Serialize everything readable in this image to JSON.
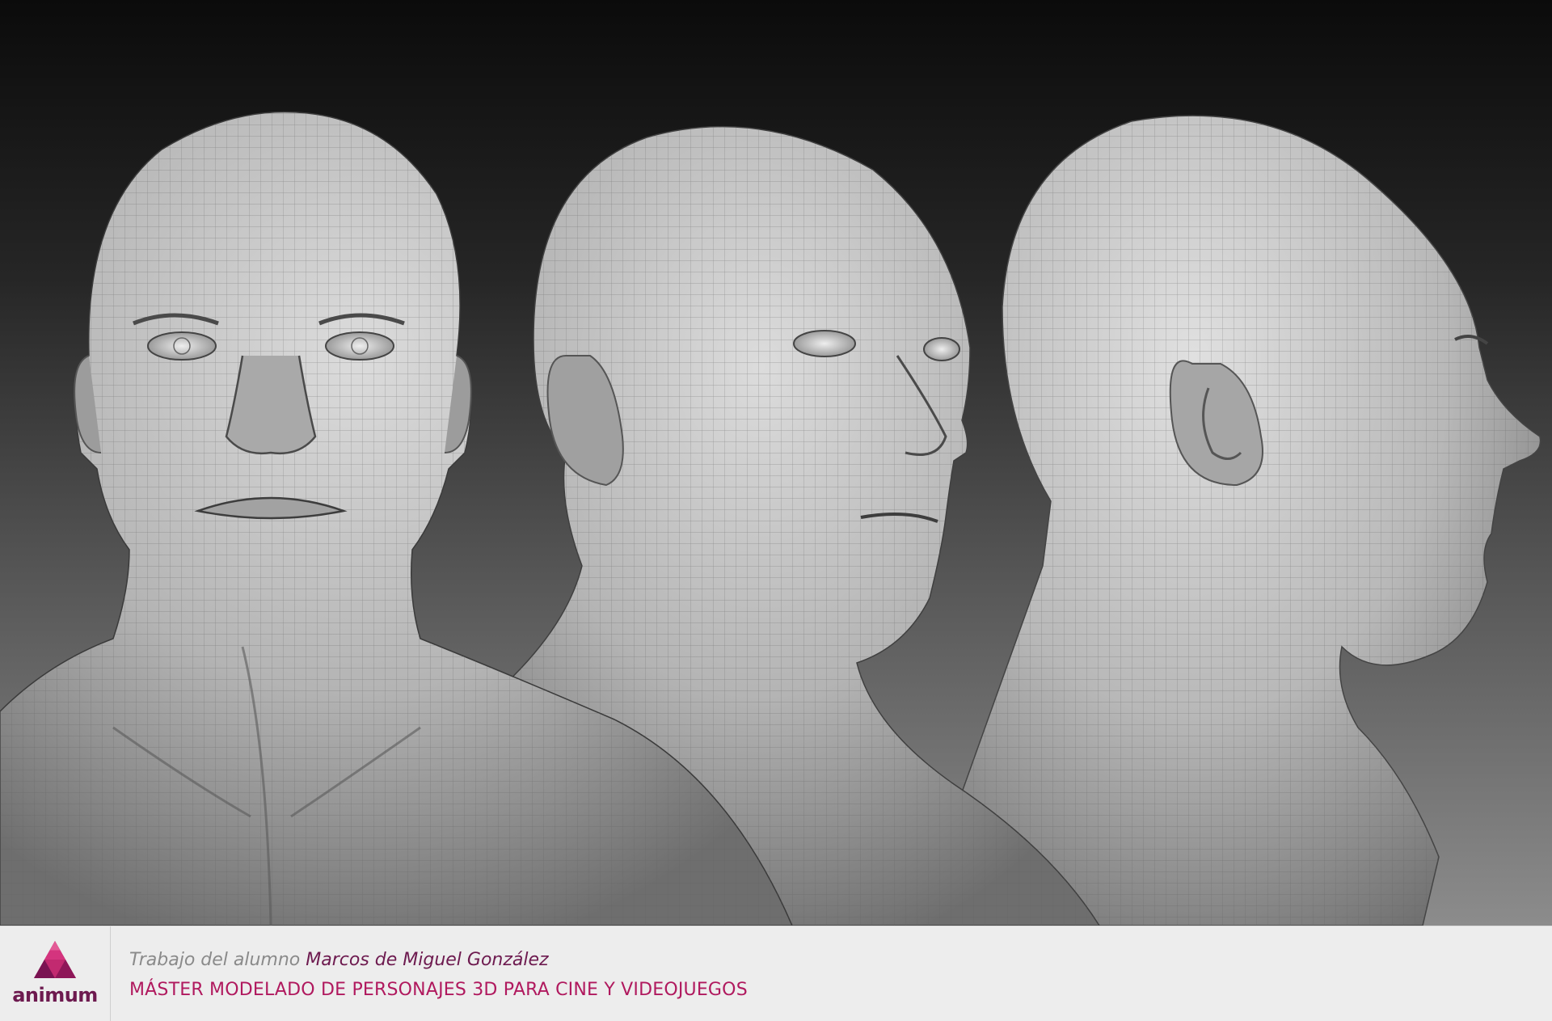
{
  "footer": {
    "logo_text": "animum",
    "credit_prefix": "Trabajo del alumno ",
    "credit_name": "Marcos de Miguel González",
    "course_title": "MÁSTER MODELADO DE PERSONAJES 3D PARA CINE Y VIDEOJUEGOS"
  },
  "colors": {
    "brand_dark": "#6d1a4f",
    "brand_accent": "#b0195e",
    "footer_bg": "#ededed",
    "credit_gray": "#8a8a8a"
  },
  "render": {
    "views": [
      "front-view",
      "three-quarter-view",
      "side-view"
    ]
  }
}
